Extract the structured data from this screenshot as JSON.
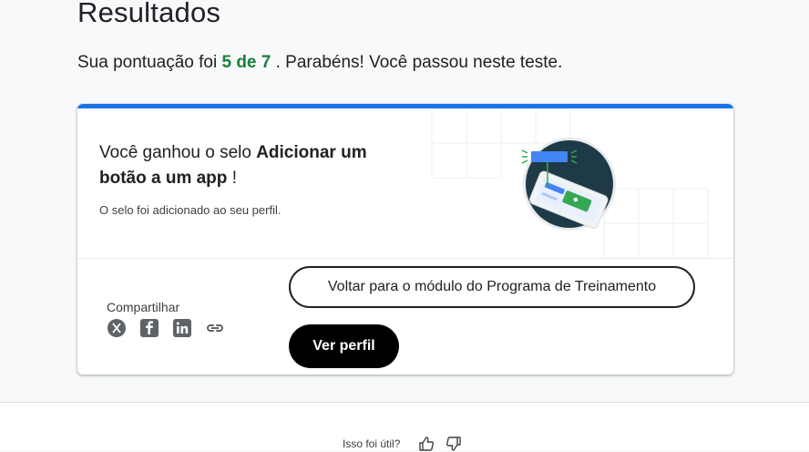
{
  "page": {
    "title": "Resultados",
    "score_prefix": "Sua pontuação foi",
    "score_value": "5 de 7",
    "score_suffix": ". Parabéns! Você passou neste teste."
  },
  "badge_card": {
    "message_prefix": "Você ganhou o selo",
    "badge_name": "Adicionar um botão a um app",
    "message_suffix": "!",
    "note": "O selo foi adicionado ao seu perfil.",
    "accent_color": "#1a73e8"
  },
  "share": {
    "label": "Compartilhar",
    "icons": [
      "x-icon",
      "facebook-icon",
      "linkedin-icon",
      "link-icon"
    ]
  },
  "actions": {
    "back_label": "Voltar para o módulo do Programa de Treinamento",
    "profile_label": "Ver perfil"
  },
  "feedback": {
    "question": "Isso foi útil?",
    "icons": [
      "thumbs-up-icon",
      "thumbs-down-icon"
    ]
  }
}
